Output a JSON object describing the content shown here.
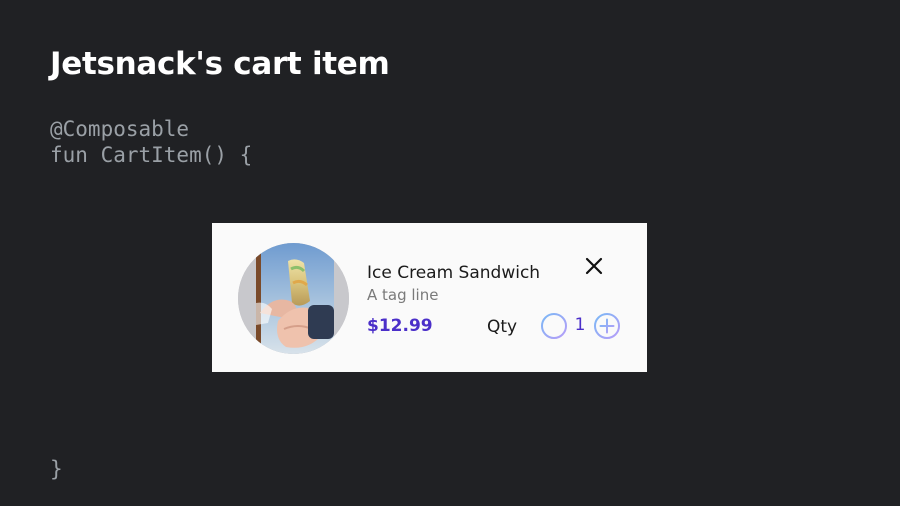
{
  "slide": {
    "title": "Jetsnack's cart item",
    "code_annotation": "@Composable",
    "code_signature": "fun CartItem() {",
    "code_closing": "}"
  },
  "cart_item": {
    "name": "Ice Cream Sandwich",
    "tagline": "A tag line",
    "price": "$12.99",
    "qty_label": "Qty",
    "quantity": "1",
    "image_icon": "ice-cream-sandwich-photo",
    "remove_icon": "close-icon",
    "decrease_icon": "minus-circle-icon",
    "increase_icon": "plus-circle-icon"
  },
  "colors": {
    "background": "#202124",
    "title": "#ffffff",
    "code": "#9aa0a6",
    "card": "#fafafa",
    "price_accent": "#4b2fc9",
    "qty_button_gradient_start": "#7ab8f5",
    "qty_button_gradient_end": "#b69df8"
  }
}
